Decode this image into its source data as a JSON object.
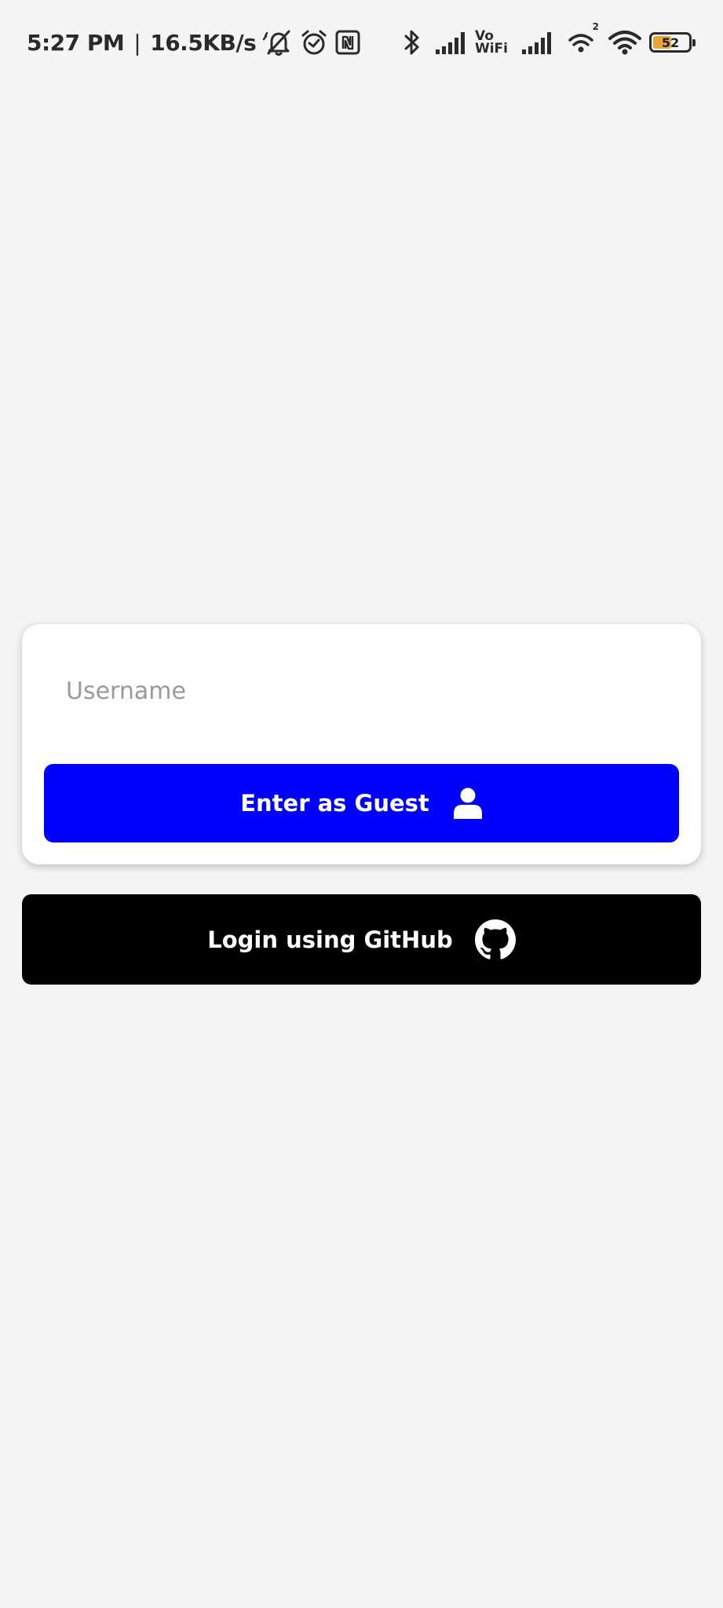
{
  "status_bar": {
    "time": "5:27 PM",
    "separator": "|",
    "network_speed": "16.5KB/s",
    "left_icons": [
      "mute-bell-icon",
      "alarm-icon",
      "nfc-icon"
    ],
    "right_icons": [
      "bluetooth-icon",
      "signal-icon",
      "vowifi-icon",
      "signal-icon",
      "wifi-calling-icon",
      "wifi-icon",
      "battery-icon"
    ],
    "vowifi_top": "Vo",
    "vowifi_bottom": "WiFi",
    "hotspot_badge": "2",
    "battery_level": "52",
    "battery_fraction": 0.52,
    "battery_color": "#e8a33a"
  },
  "login": {
    "username_placeholder": "Username",
    "username_value": "",
    "guest_button_label": "Enter as Guest",
    "guest_button_icon": "user-icon",
    "guest_button_color": "#0000ff",
    "github_button_label": "Login using GitHub",
    "github_button_icon": "github-icon",
    "github_button_color": "#000000"
  }
}
